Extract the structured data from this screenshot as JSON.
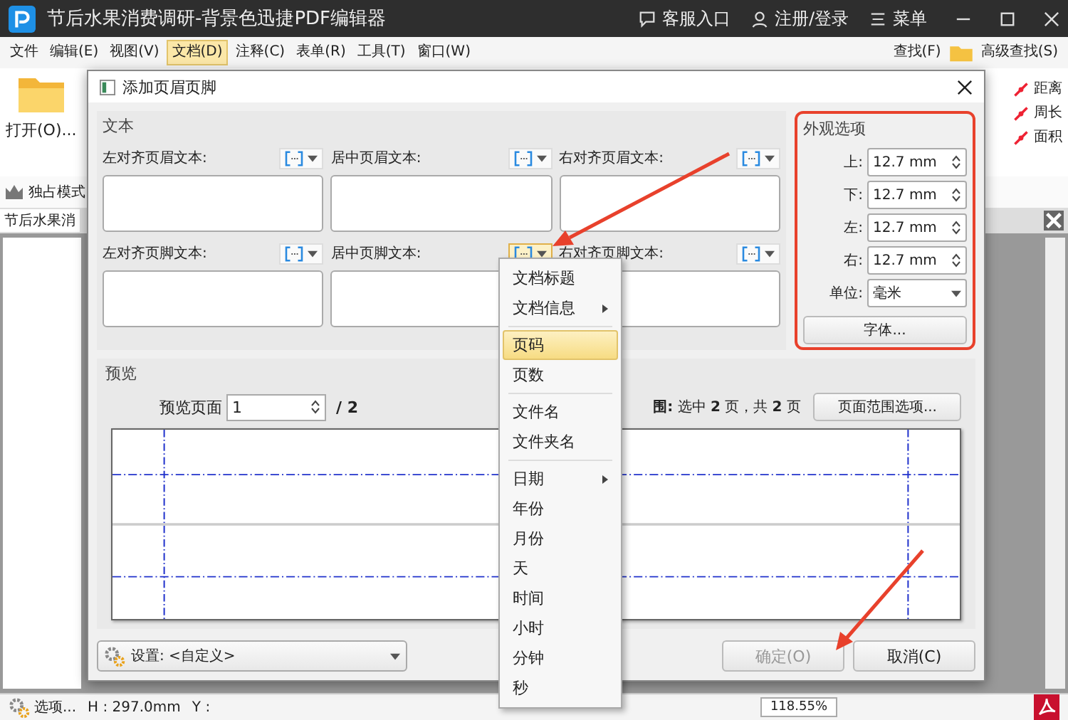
{
  "app": {
    "title": "节后水果消费调研-背景色迅捷PDF编辑器",
    "header_links": [
      {
        "kind": "chat",
        "label": "客服入口"
      },
      {
        "kind": "user",
        "label": "注册/登录"
      },
      {
        "kind": "menu",
        "label": "菜单"
      }
    ],
    "menu": [
      {
        "label": "文件",
        "selected": false
      },
      {
        "label": "编辑(E)",
        "selected": false
      },
      {
        "label": "视图(V)",
        "selected": false
      },
      {
        "label": "文档(D)",
        "selected": true
      },
      {
        "label": "注释(C)",
        "selected": false
      },
      {
        "label": "表单(R)",
        "selected": false
      },
      {
        "label": "工具(T)",
        "selected": false
      },
      {
        "label": "窗口(W)",
        "selected": false
      }
    ],
    "search_tools": [
      "查找(F)",
      "高级查找(S)"
    ],
    "open_label": "打开(O)...",
    "exclusive_mode": "独占模式",
    "measure_tools": [
      "距离",
      "周长",
      "面积"
    ],
    "doc_tab": "节后水果消",
    "status": {
      "options": "选项...",
      "height": "H : 297.0mm",
      "y": "Y :",
      "zoom": "118.55%"
    }
  },
  "dialog": {
    "title": "添加页眉页脚",
    "text_group": {
      "title": "文本",
      "fields": [
        {
          "label": "左对齐页眉文本:",
          "active": false
        },
        {
          "label": "居中页眉文本:",
          "active": false
        },
        {
          "label": "右对齐页眉文本:",
          "active": false
        },
        {
          "label": "左对齐页脚文本:",
          "active": false
        },
        {
          "label": "居中页脚文本:",
          "active": true
        },
        {
          "label": "右对齐页脚文本:",
          "active": false
        }
      ]
    },
    "appearance": {
      "title": "外观选项",
      "margins": [
        {
          "label": "上:",
          "value": "12.7 mm"
        },
        {
          "label": "下:",
          "value": "12.7 mm"
        },
        {
          "label": "左:",
          "value": "12.7 mm"
        },
        {
          "label": "右:",
          "value": "12.7 mm"
        }
      ],
      "unit_label": "单位:",
      "unit": "毫米",
      "font_button": "字体..."
    },
    "preview": {
      "title": "预览",
      "page_label": "预览页面",
      "page": "1",
      "page_total": "/ 2",
      "range_info": "**围:** 选中 **2** 页，共 **2** 页",
      "range_button": "页面范围选项..."
    },
    "settings": {
      "label": "设置:",
      "value": "<自定义>"
    },
    "buttons": [
      {
        "label": "确定(O)",
        "disabled": true
      },
      {
        "label": "取消(C)",
        "disabled": false
      }
    ]
  },
  "insert_menu": [
    {
      "kind": "item",
      "label": "文档标题",
      "selected": false
    },
    {
      "kind": "submenu",
      "label": "文档信息",
      "selected": false
    },
    {
      "kind": "separator"
    },
    {
      "kind": "item",
      "label": "页码",
      "selected": true
    },
    {
      "kind": "item",
      "label": "页数",
      "selected": false
    },
    {
      "kind": "separator"
    },
    {
      "kind": "item",
      "label": "文件名",
      "selected": false
    },
    {
      "kind": "item",
      "label": "文件夹名",
      "selected": false
    },
    {
      "kind": "separator"
    },
    {
      "kind": "submenu",
      "label": "日期",
      "selected": false
    },
    {
      "kind": "item",
      "label": "年份",
      "selected": false
    },
    {
      "kind": "item",
      "label": "月份",
      "selected": false
    },
    {
      "kind": "item",
      "label": "天",
      "selected": false
    },
    {
      "kind": "item",
      "label": "时间",
      "selected": false
    },
    {
      "kind": "item",
      "label": "小时",
      "selected": false
    },
    {
      "kind": "item",
      "label": "分钟",
      "selected": false
    },
    {
      "kind": "item",
      "label": "秒",
      "selected": false
    }
  ]
}
